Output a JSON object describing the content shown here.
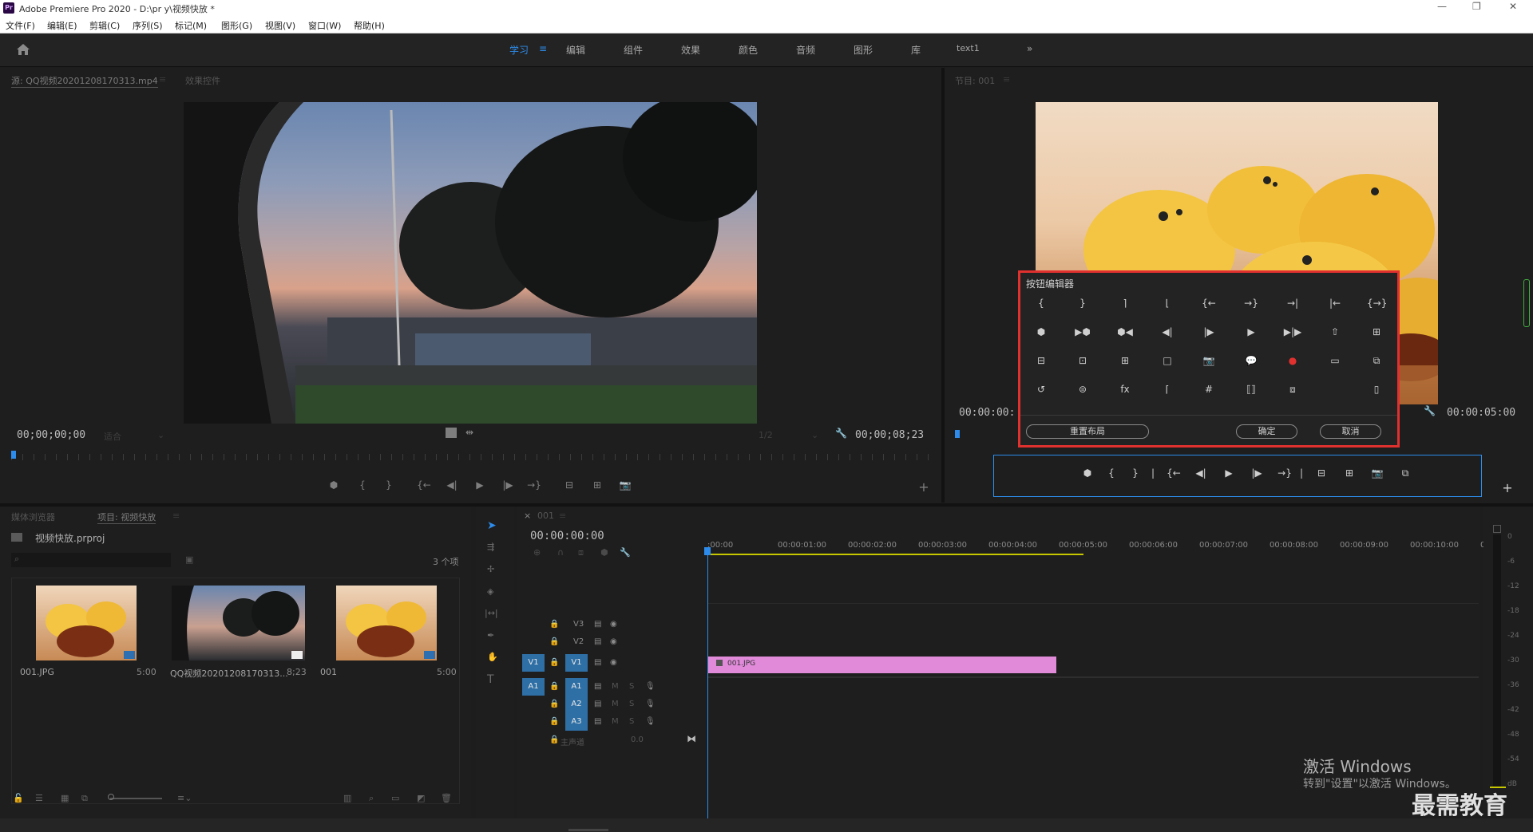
{
  "window": {
    "title": "Adobe Premiere Pro 2020 - D:\\pr y\\视频快放 *",
    "app_badge": "Pr",
    "controls": [
      "—",
      "❐",
      "✕"
    ]
  },
  "menu": [
    "文件(F)",
    "编辑(E)",
    "剪辑(C)",
    "序列(S)",
    "标记(M)",
    "图形(G)",
    "视图(V)",
    "窗口(W)",
    "帮助(H)"
  ],
  "workspaces": {
    "items": [
      "学习",
      "编辑",
      "组件",
      "效果",
      "颜色",
      "音频",
      "图形",
      "库",
      "text1"
    ],
    "active": "学习",
    "more": "»"
  },
  "source": {
    "tab1": "源: QQ视频20201208170313.mp4",
    "tab2": "效果控件",
    "tc_left": "00;00;00;00",
    "fit": "适合",
    "scale": "1/2",
    "tc_right": "00;00;08;23"
  },
  "program": {
    "tab": "节目: 001",
    "tc_left": "00:00:00:",
    "tc_right": "00:00:05:00"
  },
  "button_editor": {
    "title": "按钮编辑器",
    "reset": "重置布局",
    "ok": "确定",
    "cancel": "取消",
    "rows": [
      [
        "{",
        "}",
        "⌉",
        "⌊",
        "{←",
        "→}",
        "→|",
        "|←",
        "{→}"
      ],
      [
        "⬢",
        "▶⬢",
        "⬢◀",
        "◀|",
        "|▶",
        "▶",
        "▶|▶",
        "⇧",
        "⊞"
      ],
      [
        "⊟",
        "⊡",
        "⊞",
        "□",
        "📷",
        "💬",
        "●",
        "▭",
        "⧉"
      ],
      [
        "↺",
        "⊜",
        "fx",
        "⌈",
        "#",
        "⟦⟧",
        "⧈",
        "",
        "▯"
      ]
    ]
  },
  "transport": [
    "⬢",
    "{",
    "}",
    "|",
    "{←",
    "◀|",
    "▶",
    "|▶",
    "→}",
    "|",
    "⊟",
    "⊞",
    "📷",
    "⧉"
  ],
  "project": {
    "tab1": "媒体浏览器",
    "tab2": "项目: 视频快放",
    "file": "视频快放.prproj",
    "count": "3 个项",
    "items": [
      {
        "name": "001.JPG",
        "dur": "5:00"
      },
      {
        "name": "QQ视频20201208170313...",
        "dur": "8;23"
      },
      {
        "name": "001",
        "dur": "5:00"
      }
    ]
  },
  "timeline": {
    "tab": "001",
    "tc": "00:00:00:00",
    "ruler": [
      ":00:00",
      "00:00:01:00",
      "00:00:02:00",
      "00:00:03:00",
      "00:00:04:00",
      "00:00:05:00",
      "00:00:06:00",
      "00:00:07:00",
      "00:00:08:00",
      "00:00:09:00",
      "00:00:10:00",
      "00"
    ],
    "video_tracks": [
      "V3",
      "V2",
      "V1"
    ],
    "audio_tracks": [
      "A1",
      "A2",
      "A3"
    ],
    "src_v": "V1",
    "src_a": "A1",
    "master": "主声道",
    "master_val": "0.0",
    "clip": "001.JPG",
    "m": "M",
    "s": "S"
  },
  "meter": [
    "0",
    "-6",
    "-12",
    "-18",
    "-24",
    "-30",
    "-36",
    "-42",
    "-48",
    "-54",
    "dB"
  ],
  "watermark": {
    "line1": "激活 Windows",
    "line2": "转到\"设置\"以激活 Windows。",
    "brand": "最需教育"
  }
}
